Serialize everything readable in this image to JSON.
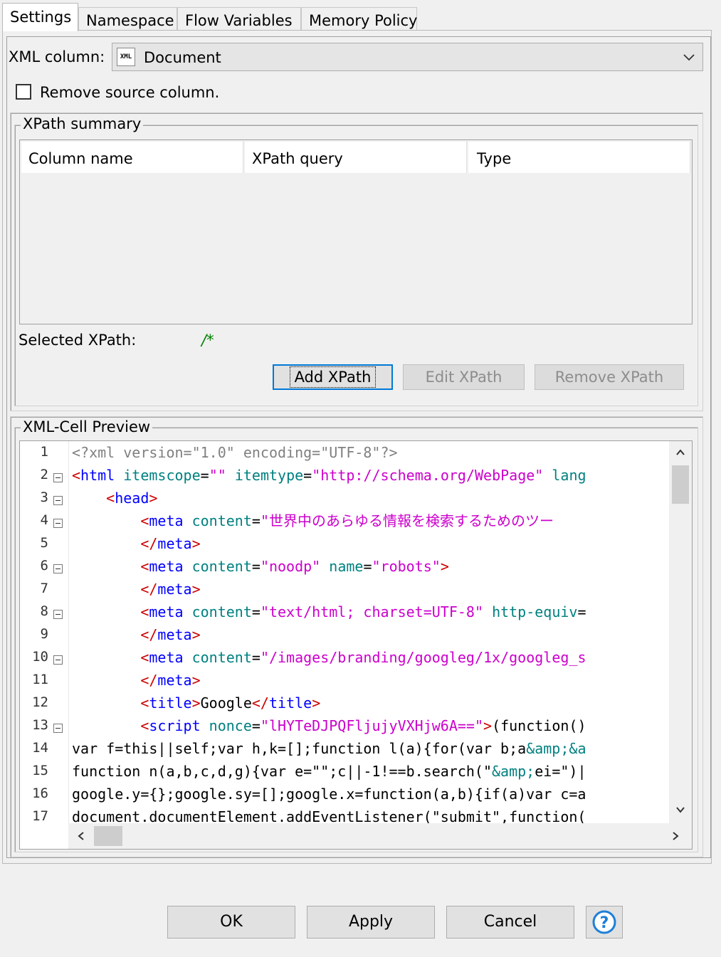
{
  "tabs": [
    "Settings",
    "Namespace",
    "Flow Variables",
    "Memory Policy"
  ],
  "xml_column": {
    "label": "XML column:",
    "icon_text": "XML",
    "value": "Document"
  },
  "remove_source": {
    "label": "Remove source column.",
    "checked": false
  },
  "xpath_summary": {
    "legend": "XPath summary",
    "columns": [
      "Column name",
      "XPath query",
      "Type"
    ],
    "selected_label": "Selected XPath:",
    "selected_value": "/*",
    "buttons": {
      "add": "Add XPath",
      "edit": "Edit XPath",
      "remove": "Remove XPath"
    }
  },
  "preview": {
    "legend": "XML-Cell Preview",
    "line_numbers": [
      "1",
      "2",
      "3",
      "4",
      "5",
      "6",
      "7",
      "8",
      "9",
      "10",
      "11",
      "12",
      "13",
      "14",
      "15",
      "16",
      "17"
    ],
    "foldable_lines": [
      2,
      3,
      4,
      6,
      8,
      10,
      13
    ],
    "lines": [
      [
        {
          "c": "pi",
          "t": "<?xml version=\"1.0\" encoding=\"UTF-8\"?>"
        }
      ],
      [
        {
          "c": "br",
          "t": "<"
        },
        {
          "c": "tag",
          "t": "html"
        },
        {
          "c": "txt",
          "t": " "
        },
        {
          "c": "attr",
          "t": "itemscope"
        },
        {
          "c": "txt",
          "t": "="
        },
        {
          "c": "str",
          "t": "\"\""
        },
        {
          "c": "txt",
          "t": " "
        },
        {
          "c": "attr",
          "t": "itemtype"
        },
        {
          "c": "txt",
          "t": "="
        },
        {
          "c": "str",
          "t": "\"http://schema.org/WebPage\""
        },
        {
          "c": "txt",
          "t": " "
        },
        {
          "c": "attr",
          "t": "lang"
        }
      ],
      [
        {
          "c": "txt",
          "t": "    "
        },
        {
          "c": "br",
          "t": "<"
        },
        {
          "c": "tag",
          "t": "head"
        },
        {
          "c": "br",
          "t": ">"
        }
      ],
      [
        {
          "c": "txt",
          "t": "        "
        },
        {
          "c": "br",
          "t": "<"
        },
        {
          "c": "tag",
          "t": "meta"
        },
        {
          "c": "txt",
          "t": " "
        },
        {
          "c": "attr",
          "t": "content"
        },
        {
          "c": "txt",
          "t": "="
        },
        {
          "c": "str",
          "t": "\"世界中のあらゆる情報を検索するためのツー"
        }
      ],
      [
        {
          "c": "txt",
          "t": "        "
        },
        {
          "c": "br",
          "t": "</"
        },
        {
          "c": "tag",
          "t": "meta"
        },
        {
          "c": "br",
          "t": ">"
        }
      ],
      [
        {
          "c": "txt",
          "t": "        "
        },
        {
          "c": "br",
          "t": "<"
        },
        {
          "c": "tag",
          "t": "meta"
        },
        {
          "c": "txt",
          "t": " "
        },
        {
          "c": "attr",
          "t": "content"
        },
        {
          "c": "txt",
          "t": "="
        },
        {
          "c": "str",
          "t": "\"noodp\""
        },
        {
          "c": "txt",
          "t": " "
        },
        {
          "c": "attr",
          "t": "name"
        },
        {
          "c": "txt",
          "t": "="
        },
        {
          "c": "str",
          "t": "\"robots\""
        },
        {
          "c": "br",
          "t": ">"
        }
      ],
      [
        {
          "c": "txt",
          "t": "        "
        },
        {
          "c": "br",
          "t": "</"
        },
        {
          "c": "tag",
          "t": "meta"
        },
        {
          "c": "br",
          "t": ">"
        }
      ],
      [
        {
          "c": "txt",
          "t": "        "
        },
        {
          "c": "br",
          "t": "<"
        },
        {
          "c": "tag",
          "t": "meta"
        },
        {
          "c": "txt",
          "t": " "
        },
        {
          "c": "attr",
          "t": "content"
        },
        {
          "c": "txt",
          "t": "="
        },
        {
          "c": "str",
          "t": "\"text/html; charset=UTF-8\""
        },
        {
          "c": "txt",
          "t": " "
        },
        {
          "c": "attr",
          "t": "http-equiv"
        },
        {
          "c": "txt",
          "t": "="
        }
      ],
      [
        {
          "c": "txt",
          "t": "        "
        },
        {
          "c": "br",
          "t": "</"
        },
        {
          "c": "tag",
          "t": "meta"
        },
        {
          "c": "br",
          "t": ">"
        }
      ],
      [
        {
          "c": "txt",
          "t": "        "
        },
        {
          "c": "br",
          "t": "<"
        },
        {
          "c": "tag",
          "t": "meta"
        },
        {
          "c": "txt",
          "t": " "
        },
        {
          "c": "attr",
          "t": "content"
        },
        {
          "c": "txt",
          "t": "="
        },
        {
          "c": "str",
          "t": "\"/images/branding/googleg/1x/googleg_s"
        }
      ],
      [
        {
          "c": "txt",
          "t": "        "
        },
        {
          "c": "br",
          "t": "</"
        },
        {
          "c": "tag",
          "t": "meta"
        },
        {
          "c": "br",
          "t": ">"
        }
      ],
      [
        {
          "c": "txt",
          "t": "        "
        },
        {
          "c": "br",
          "t": "<"
        },
        {
          "c": "tag",
          "t": "title"
        },
        {
          "c": "br",
          "t": ">"
        },
        {
          "c": "txt",
          "t": "Google"
        },
        {
          "c": "br",
          "t": "</"
        },
        {
          "c": "tag",
          "t": "title"
        },
        {
          "c": "br",
          "t": ">"
        }
      ],
      [
        {
          "c": "txt",
          "t": "        "
        },
        {
          "c": "br",
          "t": "<"
        },
        {
          "c": "tag",
          "t": "script"
        },
        {
          "c": "txt",
          "t": " "
        },
        {
          "c": "attr",
          "t": "nonce"
        },
        {
          "c": "txt",
          "t": "="
        },
        {
          "c": "str",
          "t": "\"lHYTeDJPQFljujyVXHjw6A==\""
        },
        {
          "c": "br",
          "t": ">"
        },
        {
          "c": "txt",
          "t": "(function()"
        }
      ],
      [
        {
          "c": "txt",
          "t": "var f=this||self;var h,k=[];function l(a){for(var b;a"
        },
        {
          "c": "attr",
          "t": "&amp;"
        },
        {
          "c": "attr",
          "t": "&a"
        }
      ],
      [
        {
          "c": "txt",
          "t": "function n(a,b,c,d,g){var e=\"\";c||-1!==b.search(\""
        },
        {
          "c": "attr",
          "t": "&amp;"
        },
        {
          "c": "txt",
          "t": "ei=\")|"
        }
      ],
      [
        {
          "c": "txt",
          "t": "google.y={};google.sy=[];google.x=function(a,b){if(a)var c=a"
        }
      ],
      [
        {
          "c": "txt",
          "t": "document.documentElement.addEventListener(\"submit\",function("
        }
      ]
    ]
  },
  "dialog_buttons": {
    "ok": "OK",
    "apply": "Apply",
    "cancel": "Cancel",
    "help": "?"
  }
}
